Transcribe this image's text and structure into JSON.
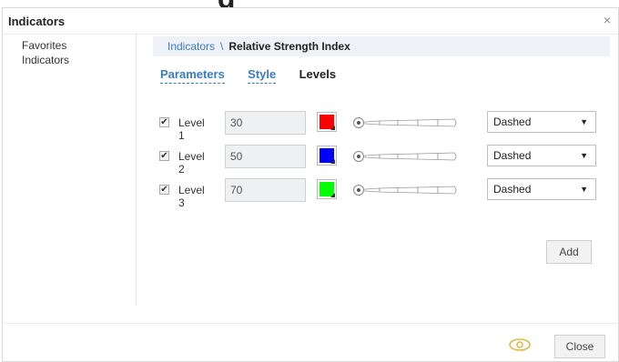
{
  "dialog": {
    "title": "Indicators",
    "close_glyph": "×"
  },
  "sidebar": {
    "items": [
      {
        "label": "Favorites"
      },
      {
        "label": "Indicators"
      }
    ]
  },
  "breadcrumb": {
    "parent": "Indicators",
    "separator": "\\",
    "current": "Relative Strength Index"
  },
  "tabs": [
    {
      "label": "Parameters",
      "active": false
    },
    {
      "label": "Style",
      "active": false
    },
    {
      "label": "Levels",
      "active": true
    }
  ],
  "levels": [
    {
      "checked": true,
      "label": "Level 1",
      "value": "30",
      "color": "#ff0000",
      "line_style": "Dashed",
      "slider_icon": "line-width-slider"
    },
    {
      "checked": true,
      "label": "Level 2",
      "value": "50",
      "color": "#0000ff",
      "line_style": "Dashed",
      "slider_icon": "line-width-slider"
    },
    {
      "checked": true,
      "label": "Level 3",
      "value": "70",
      "color": "#00ff00",
      "line_style": "Dashed",
      "slider_icon": "line-width-slider"
    }
  ],
  "buttons": {
    "add": "Add",
    "close": "Close"
  },
  "icons": {
    "eye": "eye-icon",
    "checkmark": "✔",
    "dropdown_arrow": "▼"
  }
}
